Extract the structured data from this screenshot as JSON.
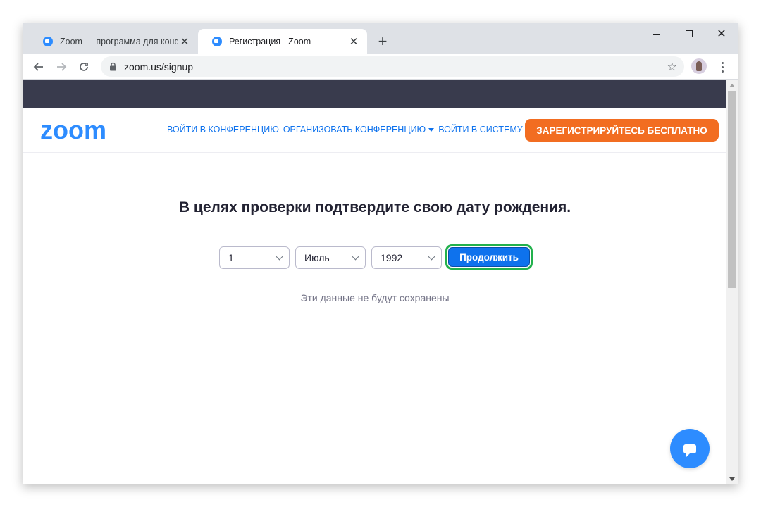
{
  "browser": {
    "tabs": [
      {
        "title": "Zoom — программа для конфер",
        "icon": "zoom-favicon",
        "active": false
      },
      {
        "title": "Регистрация - Zoom",
        "icon": "zoom-favicon",
        "active": true
      }
    ],
    "new_tab_label": "+",
    "url": "zoom.us/signup",
    "window_controls": [
      "minimize-icon",
      "maximize-icon",
      "close-icon"
    ]
  },
  "site": {
    "logo": "zoom",
    "nav": {
      "join": "ВОЙТИ В КОНФЕРЕНЦИЮ",
      "host": "ОРГАНИЗОВАТЬ КОНФЕРЕНЦИЮ",
      "signin": "ВОЙТИ В СИСТЕМУ"
    },
    "signup_button": "ЗАРЕГИСТРИРУЙТЕСЬ БЕСПЛАТНО",
    "colors": {
      "brand": "#2d8cff",
      "signup": "#f26d21",
      "topbar": "#393b4d",
      "primary_button": "#0e72ed",
      "highlight": "#22b14c"
    }
  },
  "form": {
    "heading": "В целях проверки подтвердите свою дату рождения.",
    "day": "1",
    "month": "Июль",
    "year": "1992",
    "continue_label": "Продолжить",
    "note": "Эти данные не будут сохранены"
  }
}
